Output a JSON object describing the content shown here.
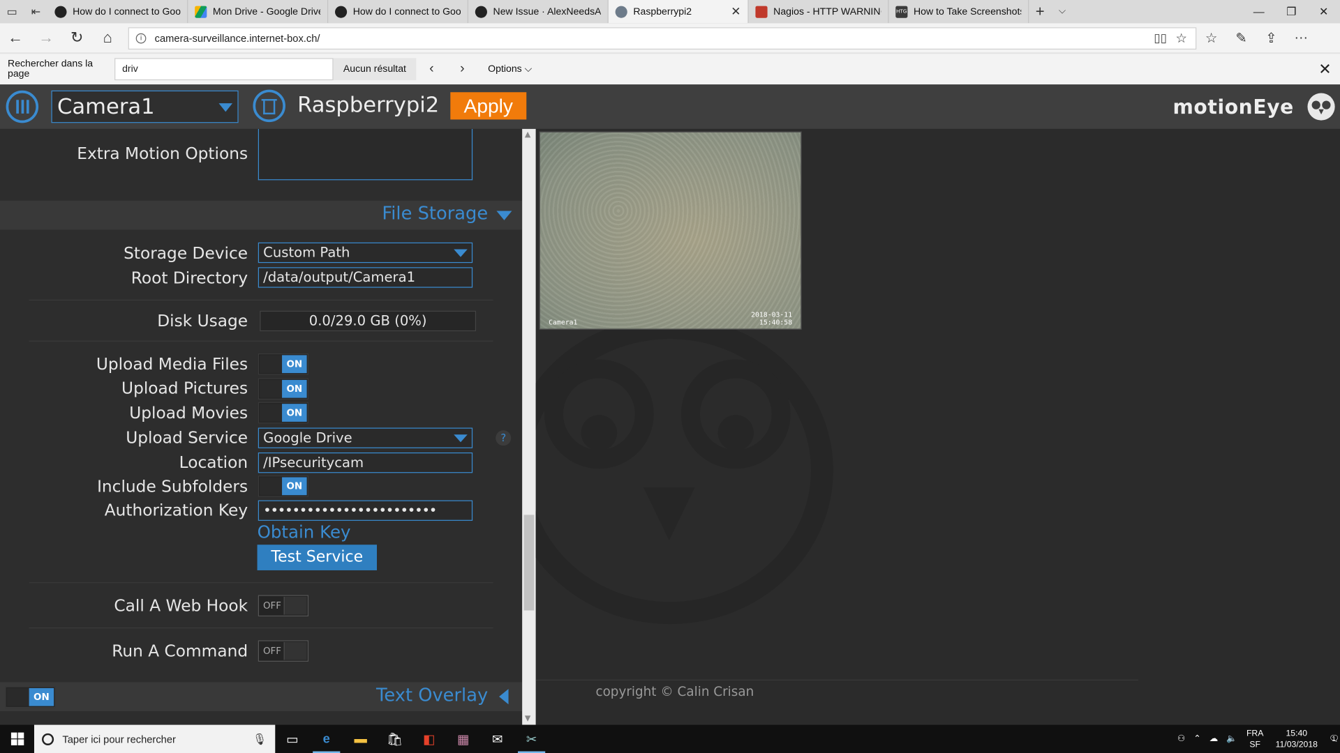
{
  "browser": {
    "tabs": [
      {
        "title": "How do I connect to Google",
        "icon": "github-icon"
      },
      {
        "title": "Mon Drive - Google Drive",
        "icon": "google-drive-icon"
      },
      {
        "title": "How do I connect to Googl",
        "icon": "github-icon"
      },
      {
        "title": "New Issue · AlexNeedsAndF",
        "icon": "github-icon"
      },
      {
        "title": "Raspberrypi2",
        "icon": "globe-icon",
        "active": true
      },
      {
        "title": "Nagios - HTTP WARNING: F",
        "icon": "nagios-icon"
      },
      {
        "title": "How to Take Screenshots in",
        "icon": "htg-icon"
      }
    ],
    "url": "camera-surveillance.internet-box.ch/",
    "find": {
      "label": "Rechercher dans la page",
      "query": "driv",
      "result": "Aucun résultat",
      "options_label": "Options"
    }
  },
  "app": {
    "camera_select": "Camera1",
    "camera_name": "Raspberrypi2",
    "apply_label": "Apply",
    "logo_text": "motionEye",
    "accent_color": "#3a8bd0",
    "apply_color": "#f17b0b"
  },
  "settings": {
    "extra_motion_options_label": "Extra Motion Options",
    "file_storage_title": "File Storage",
    "storage_device_label": "Storage Device",
    "storage_device_value": "Custom Path",
    "root_directory_label": "Root Directory",
    "root_directory_value": "/data/output/Camera1",
    "disk_usage_label": "Disk Usage",
    "disk_usage_value": "0.0/29.0 GB (0%)",
    "upload_media_files_label": "Upload Media Files",
    "upload_pictures_label": "Upload Pictures",
    "upload_movies_label": "Upload Movies",
    "upload_service_label": "Upload Service",
    "upload_service_value": "Google Drive",
    "location_label": "Location",
    "location_value": "/IPsecuritycam",
    "include_subfolders_label": "Include Subfolders",
    "authorization_key_label": "Authorization Key",
    "authorization_key_value": "••••••••••••••••••••••••",
    "obtain_key_label": "Obtain Key",
    "test_service_label": "Test Service",
    "call_web_hook_label": "Call A Web Hook",
    "run_command_label": "Run A Command",
    "text_overlay_title": "Text Overlay",
    "help_label": "?",
    "on_label": "ON",
    "off_label": "OFF"
  },
  "preview": {
    "camera_label": "Camera1",
    "timestamp_date": "2018-03-11",
    "timestamp_time": "15:40:58",
    "copyright": "copyright © Calin Crisan"
  },
  "taskbar": {
    "search_placeholder": "Taper ici pour rechercher",
    "lang_top": "FRA",
    "lang_bottom": "SF",
    "time": "15:40",
    "date": "11/03/2018",
    "notification_count": "1"
  }
}
